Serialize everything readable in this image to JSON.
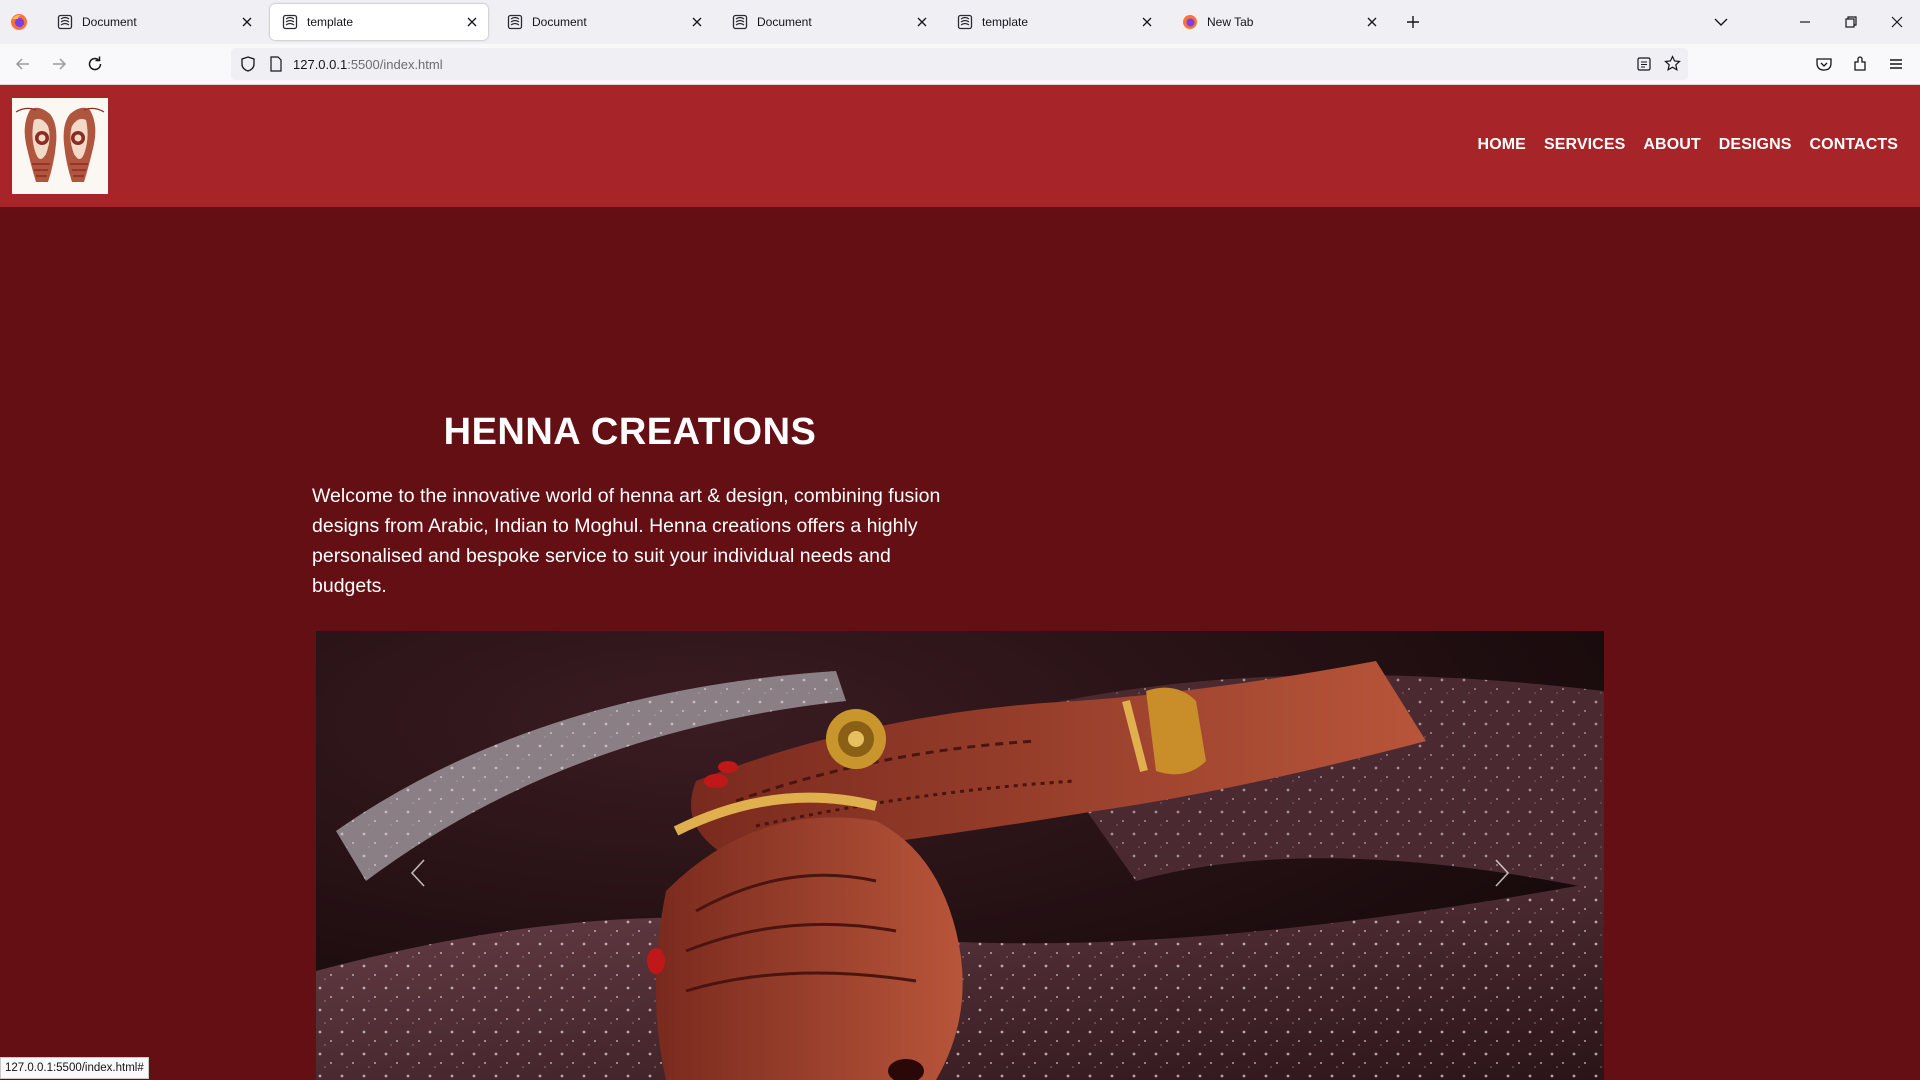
{
  "browser": {
    "tabs": [
      {
        "label": "Document",
        "icon": "server-favicon",
        "active": false
      },
      {
        "label": "template",
        "icon": "server-favicon",
        "active": true
      },
      {
        "label": "Document",
        "icon": "server-favicon",
        "active": false
      },
      {
        "label": "Document",
        "icon": "server-favicon",
        "active": false
      },
      {
        "label": "template",
        "icon": "server-favicon",
        "active": false
      },
      {
        "label": "New Tab",
        "icon": "firefox-favicon",
        "active": false
      }
    ],
    "url_host": "127.0.0.1",
    "url_path": ":5500/index.html",
    "status_link": "127.0.0.1:5500/index.html#"
  },
  "site": {
    "nav": [
      "HOME",
      "SERVICES",
      "ABOUT",
      "DESIGNS",
      "CONTACTS"
    ],
    "hero": {
      "title": "HENNA CREATIONS",
      "text": "Welcome to the innovative world of henna art & design, combining fusion designs from Arabic, Indian to Moghul. Henna creations offers a highly personalised and bespoke service to suit your individual needs and budgets."
    }
  },
  "colors": {
    "header": "#a72428",
    "page_bg": "#640f14",
    "text": "#ffffff"
  }
}
